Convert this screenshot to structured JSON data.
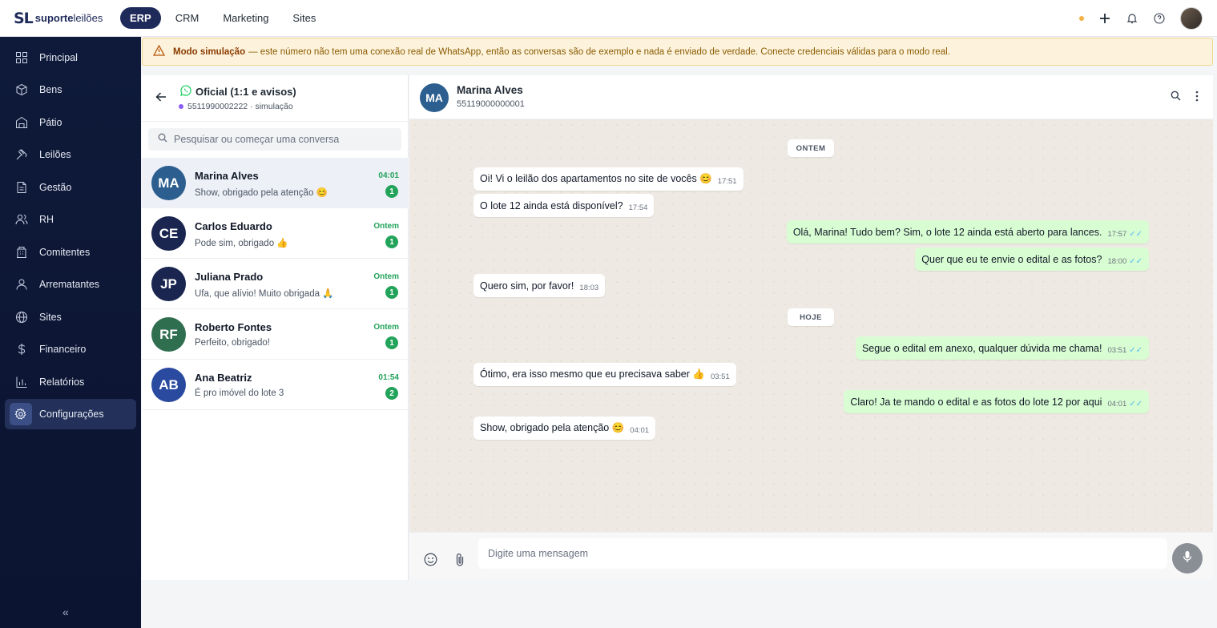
{
  "brand": {
    "mark": "SL",
    "name_bold": "suporte",
    "name_light": "leilões"
  },
  "nav": [
    {
      "label": "ERP",
      "active": true
    },
    {
      "label": "CRM",
      "active": false
    },
    {
      "label": "Marketing",
      "active": false
    },
    {
      "label": "Sites",
      "active": false
    }
  ],
  "sidebar": {
    "items": [
      {
        "label": "Principal",
        "icon": "dashboard-icon"
      },
      {
        "label": "Bens",
        "icon": "box-icon"
      },
      {
        "label": "Pátio",
        "icon": "warehouse-icon"
      },
      {
        "label": "Leilões",
        "icon": "gavel-icon"
      },
      {
        "label": "Gestão",
        "icon": "document-icon"
      },
      {
        "label": "RH",
        "icon": "users-icon"
      },
      {
        "label": "Comitentes",
        "icon": "building-icon"
      },
      {
        "label": "Arrematantes",
        "icon": "user-icon"
      },
      {
        "label": "Sites",
        "icon": "globe-icon"
      },
      {
        "label": "Financeiro",
        "icon": "dollar-icon"
      },
      {
        "label": "Relatórios",
        "icon": "bar-chart-icon"
      },
      {
        "label": "Configurações",
        "icon": "gear-icon",
        "active": true
      }
    ],
    "collapse": "«"
  },
  "banner": {
    "title": "Modo simulação",
    "text": "— este número não tem uma conexão real de WhatsApp, então as conversas são de exemplo e nada é enviado de verdade. Conecte credenciais válidas para o modo real."
  },
  "channel": {
    "title": "Oficial (1:1 e avisos)",
    "subtitle": "5511990002222 · simulação"
  },
  "search": {
    "placeholder": "Pesquisar ou começar uma conversa"
  },
  "conversations": [
    {
      "initials": "MA",
      "name": "Marina Alves",
      "last": "Show, obrigado pela atenção 😊",
      "time": "04:01",
      "unread": "1",
      "color": "#2c5f8f",
      "active": true
    },
    {
      "initials": "CE",
      "name": "Carlos Eduardo",
      "last": "Pode sim, obrigado 👍",
      "time": "Ontem",
      "unread": "1",
      "color": "#1a2550"
    },
    {
      "initials": "JP",
      "name": "Juliana Prado",
      "last": "Ufa, que alívio! Muito obrigada 🙏",
      "time": "Ontem",
      "unread": "1",
      "color": "#1a2550"
    },
    {
      "initials": "RF",
      "name": "Roberto Fontes",
      "last": "Perfeito, obrigado!",
      "time": "Ontem",
      "unread": "1",
      "color": "#2f6e4f"
    },
    {
      "initials": "AB",
      "name": "Ana Beatriz",
      "last": "É pro imóvel do lote 3",
      "time": "01:54",
      "unread": "2",
      "color": "#2a4aa0"
    }
  ],
  "chat": {
    "initials": "MA",
    "name": "Marina Alves",
    "phone": "55119000000001",
    "days": [
      "ONTEM",
      "HOJE"
    ],
    "messages": [
      {
        "dir": "in",
        "text": "Oi! Vi o leilão dos apartamentos no site de vocês 😊",
        "time": "17:51"
      },
      {
        "dir": "in",
        "text": "O lote 12 ainda está disponível?",
        "time": "17:54"
      },
      {
        "dir": "out",
        "text": "Olá, Marina! Tudo bem? Sim, o lote 12 ainda está aberto para lances.",
        "time": "17:57"
      },
      {
        "dir": "out",
        "text": "Quer que eu te envie o edital e as fotos?",
        "time": "18:00"
      },
      {
        "dir": "in",
        "text": "Quero sim, por favor!",
        "time": "18:03"
      },
      {
        "dir": "out",
        "text": "Segue o edital em anexo, qualquer dúvida me chama!",
        "time": "03:51"
      },
      {
        "dir": "in",
        "text": "Ótimo, era isso mesmo que eu precisava saber 👍",
        "time": "03:51"
      },
      {
        "dir": "out",
        "text": "Claro! Ja te mando o edital e as fotos do lote 12 por aqui",
        "time": "04:01"
      },
      {
        "dir": "in",
        "text": "Show, obrigado pela atenção 😊",
        "time": "04:01"
      }
    ]
  },
  "composer": {
    "placeholder": "Digite uma mensagem"
  }
}
